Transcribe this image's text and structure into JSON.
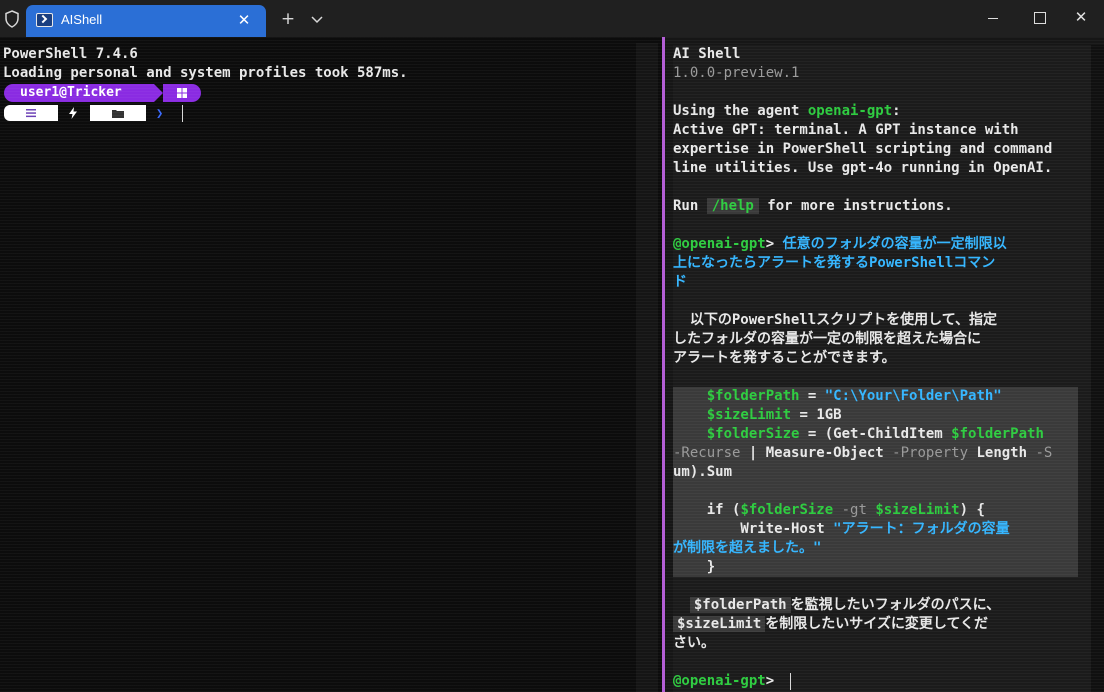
{
  "window": {
    "tab_title": "AIShell",
    "tab_close": "✕",
    "new_tab": "+",
    "close_glyph": "✕"
  },
  "left": {
    "line1": "PowerShell 7.4.6",
    "line2": "Loading personal and system profiles took 587ms.",
    "prompt_user": "user1@Tricker",
    "prompt_os": "",
    "prompt_chevron": "❯"
  },
  "right": {
    "title": "AI Shell",
    "version": "1.0.0-preview.1",
    "agent_prefix": "Using the agent ",
    "agent_name": "openai-gpt",
    "agent_suffix": ":",
    "desc1": "Active GPT: terminal. A GPT instance with",
    "desc2": "expertise in PowerShell scripting and command",
    "desc3": "line utilities. Use gpt-4o running in OpenAI.",
    "run_prefix": "Run ",
    "run_cmd": "/help",
    "run_suffix": " for more instructions.",
    "prompt_name": "@openai-gpt",
    "prompt_gt": "> ",
    "query1": "任意のフォルダの容量が一定制限以",
    "query2": "上になったらアラートを発するPowerShellコマン",
    "query3": "ド",
    "answer1": "  以下のPowerShellスクリプトを使用して、指定",
    "answer2": "したフォルダの容量が一定の制限を超えた場合に",
    "answer3": "アラートを発することができます。",
    "code": {
      "l1_var": "    $folderPath",
      "l1_eq": " = ",
      "l1_str": "\"C:\\Your\\Folder\\Path\"",
      "l2_var": "    $sizeLimit",
      "l2_eq": " = ",
      "l2_val": "1GB",
      "l3_var": "    $folderSize",
      "l3_eq": " = (",
      "l3_cmd": "Get-ChildItem ",
      "l3_arg": "$folderPath",
      "l4_p1": "-Recurse",
      "l4_pipe": " | ",
      "l4_cmd": "Measure-Object",
      "l4_p2": " -Property ",
      "l4_len": "Length",
      "l4_p3": " -S",
      "l5": "um).Sum",
      "l6_if": "    if (",
      "l6_var": "$folderSize",
      "l6_op": " -gt ",
      "l6_var2": "$sizeLimit",
      "l6_end": ") {",
      "l7_cmd": "        Write-Host ",
      "l7_str": "\"アラート：フォルダの容量",
      "l8_str": "が制限を超えました。\"",
      "l9": "    }"
    },
    "note_var1": "$folderPath",
    "note1": "を監視したいフォルダのパスに、",
    "note_var2": "$sizeLimit",
    "note2": "を制限したいサイズに変更してくだ",
    "note3": "さい。",
    "final_prompt": "@openai-gpt",
    "final_gt": "> "
  }
}
